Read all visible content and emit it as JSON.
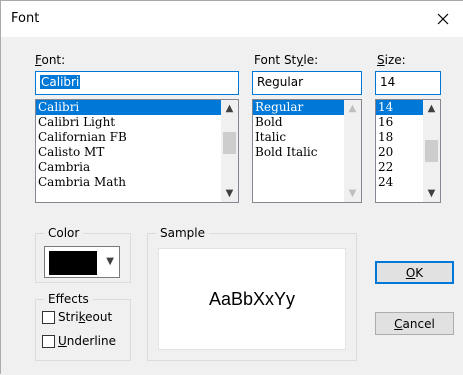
{
  "window": {
    "title": "Font",
    "close_glyph": "✕"
  },
  "font": {
    "label_pre": "",
    "label_u": "F",
    "label_post": "ont:",
    "value": "Calibri",
    "items": [
      "Calibri",
      "Calibri Light",
      "Californian FB",
      "Calisto MT",
      "Cambria",
      "Cambria Math"
    ],
    "selected_index": 0
  },
  "style": {
    "label_pre": "Font St",
    "label_u": "y",
    "label_post": "le:",
    "value": "Regular",
    "items": [
      "Regular",
      "Bold",
      "Italic",
      "Bold Italic"
    ],
    "selected_index": 0
  },
  "size": {
    "label_pre": "",
    "label_u": "S",
    "label_post": "ize:",
    "value": "14",
    "items": [
      "14",
      "16",
      "18",
      "20",
      "22",
      "24"
    ],
    "selected_index": 0
  },
  "color": {
    "label": "Color",
    "value": "#000000"
  },
  "sample": {
    "label": "Sample",
    "text": "AaBbXxYy"
  },
  "effects": {
    "label": "Effects",
    "strikeout": {
      "pre": "Stri",
      "u": "k",
      "post": "eout",
      "checked": false
    },
    "underline": {
      "pre": "",
      "u": "U",
      "post": "nderline",
      "checked": false
    }
  },
  "buttons": {
    "ok": {
      "pre": "",
      "u": "O",
      "post": "K"
    },
    "cancel": {
      "pre": "",
      "u": "C",
      "post": "ancel"
    }
  },
  "icons": {
    "scroll_up": "▲",
    "scroll_down": "▼",
    "dropdown": "▼"
  },
  "colors": {
    "accent": "#0078d7",
    "client_bg": "#f0f0f0"
  }
}
